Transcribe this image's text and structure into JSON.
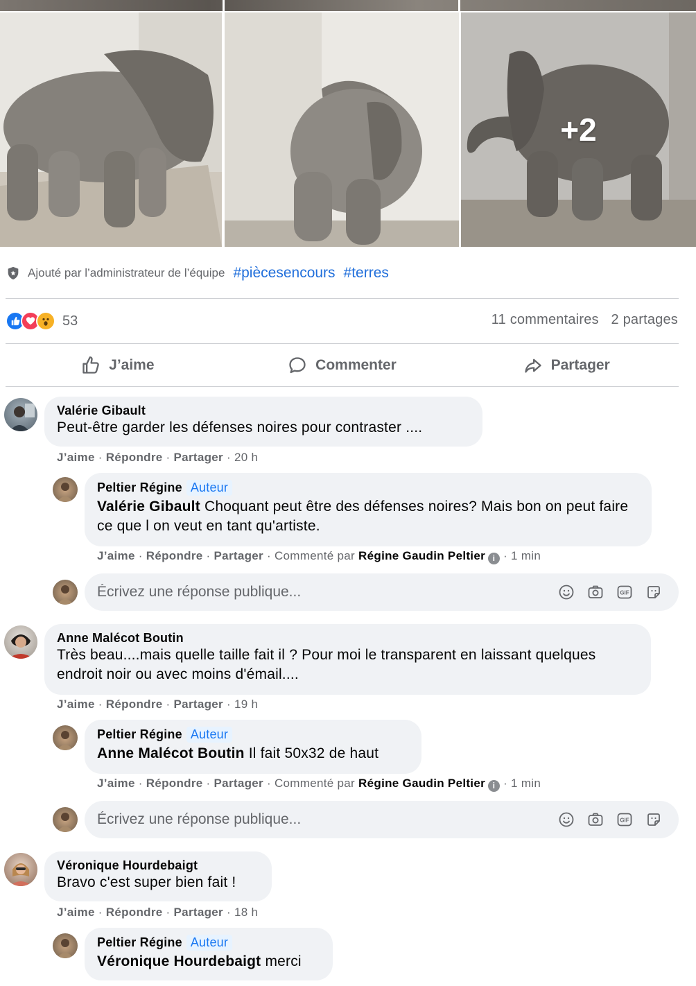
{
  "post": {
    "photos": {
      "more_label": "+2"
    },
    "admin_note": "Ajouté par l’administrateur de l’équipe",
    "hashtags": [
      "#piècesencours",
      "#terres"
    ],
    "reaction_count": "53",
    "comments_count": "11 commentaires",
    "shares_count": "2 partages",
    "actions": {
      "like": "J’aime",
      "comment": "Commenter",
      "share": "Partager"
    }
  },
  "meta_labels": {
    "like": "J’aime",
    "reply": "Répondre",
    "share": "Partager",
    "commented_by": "Commenté par",
    "sep": "·"
  },
  "reply_placeholder": "Écrivez une réponse publique...",
  "comments": [
    {
      "author": "Valérie Gibault",
      "text": "Peut-être garder les défenses noires pour contraster ....",
      "time": "20 h",
      "reply": {
        "author": "Peltier Régine",
        "badge": "Auteur",
        "mention": "Valérie Gibault",
        "text": "Choquant peut être des défenses noires? Mais bon on peut faire ce que l on veut en tant qu'artiste.",
        "commented_by": "Régine Gaudin Peltier",
        "time": "1 min"
      }
    },
    {
      "author": "Anne Malécot Boutin",
      "text": "Très beau....mais quelle taille fait il ? Pour moi le transparent en laissant quelques endroit noir ou avec moins d'émail....",
      "time": "19 h",
      "reply": {
        "author": "Peltier Régine",
        "badge": "Auteur",
        "mention": "Anne Malécot Boutin",
        "text": "Il fait 50x32 de haut",
        "commented_by": "Régine Gaudin Peltier",
        "time": "1 min"
      }
    },
    {
      "author": "Véronique Hourdebaigt",
      "text": "Bravo c'est super bien fait !",
      "time": "18 h",
      "reply": {
        "author": "Peltier Régine",
        "badge": "Auteur",
        "mention": "Véronique Hourdebaigt",
        "text": "merci"
      }
    }
  ]
}
